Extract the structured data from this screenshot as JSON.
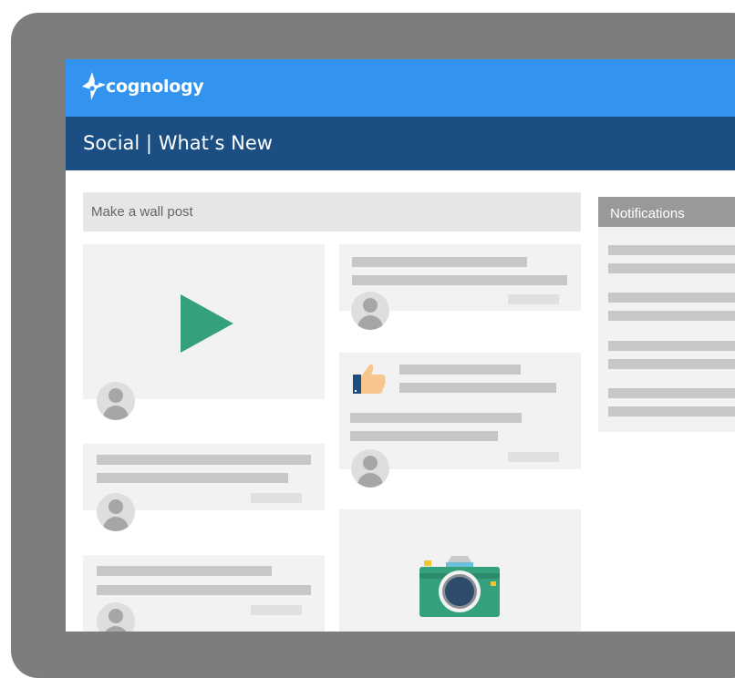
{
  "app": {
    "logo_text": "cognology",
    "page_title": "Social | What’s New",
    "brand_color": "#3394f0",
    "title_bar_color": "#1b4f84"
  },
  "wall": {
    "post_placeholder": "Make a wall post"
  },
  "notifications": {
    "title": "Notifications"
  },
  "icons": [
    "play-icon",
    "thumbs-up-icon",
    "camera-icon",
    "avatar-icon",
    "cognology-logo-icon"
  ]
}
